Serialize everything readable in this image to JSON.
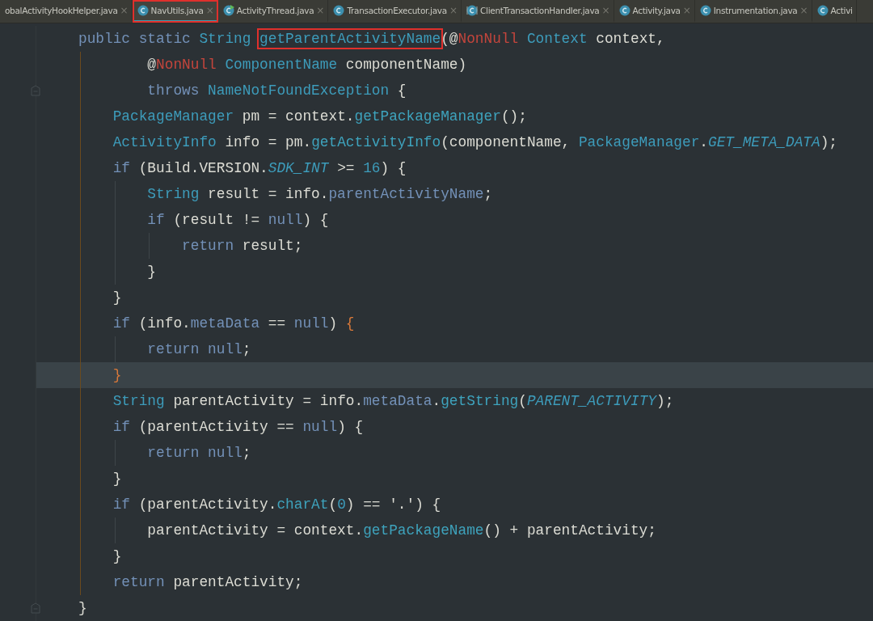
{
  "tabs": [
    {
      "label": "obalActivityHookHelper.java",
      "selected": false
    },
    {
      "label": "NavUtils.java",
      "kind": "class",
      "selected": true,
      "boxed": true
    },
    {
      "label": "ActivityThread.java",
      "kind": "class-run",
      "selected": false
    },
    {
      "label": "TransactionExecutor.java",
      "kind": "class",
      "selected": false
    },
    {
      "label": "ClientTransactionHandler.java",
      "kind": "class-abstract",
      "selected": false
    },
    {
      "label": "Activity.java",
      "kind": "class",
      "selected": false
    },
    {
      "label": "Instrumentation.java",
      "kind": "class",
      "selected": false
    },
    {
      "label": "Activi",
      "kind": "class",
      "selected": false
    }
  ],
  "close_glyph": "×",
  "code_lines": [
    {
      "tokens": [
        {
          "t": "public static ",
          "kind": "keyword"
        },
        {
          "t": "String ",
          "kind": "type"
        },
        {
          "t": "getParentActivityName",
          "kind": "type",
          "boxed": true
        },
        {
          "t": "(@",
          "kind": "plain"
        },
        {
          "t": "NonNull ",
          "kind": "annotation"
        },
        {
          "t": "Context ",
          "kind": "type"
        },
        {
          "t": "context,",
          "kind": "plain"
        }
      ]
    },
    {
      "tokens": [
        {
          "t": "        @",
          "kind": "plain"
        },
        {
          "t": "NonNull ",
          "kind": "annotation"
        },
        {
          "t": "ComponentName ",
          "kind": "type"
        },
        {
          "t": "componentName)",
          "kind": "plain"
        }
      ]
    },
    {
      "fold_marker": true,
      "tokens": [
        {
          "t": "        throws ",
          "kind": "keyword"
        },
        {
          "t": "NameNotFoundException ",
          "kind": "type"
        },
        {
          "t": "{",
          "kind": "plain"
        }
      ]
    },
    {
      "tokens": [
        {
          "t": "    PackageManager ",
          "kind": "type"
        },
        {
          "t": "pm = context.",
          "kind": "plain"
        },
        {
          "t": "getPackageManager",
          "kind": "call"
        },
        {
          "t": "();",
          "kind": "plain"
        }
      ]
    },
    {
      "tokens": [
        {
          "t": "    ActivityInfo ",
          "kind": "type"
        },
        {
          "t": "info = pm.",
          "kind": "plain"
        },
        {
          "t": "getActivityInfo",
          "kind": "call"
        },
        {
          "t": "(componentName, ",
          "kind": "plain"
        },
        {
          "t": "PackageManager",
          "kind": "type"
        },
        {
          "t": ".",
          "kind": "plain"
        },
        {
          "t": "GET_META_DATA",
          "kind": "constant"
        },
        {
          "t": ");",
          "kind": "plain"
        }
      ]
    },
    {
      "tokens": [
        {
          "t": "    if ",
          "kind": "keyword"
        },
        {
          "t": "(Build.VERSION.",
          "kind": "plain"
        },
        {
          "t": "SDK_INT",
          "kind": "constant"
        },
        {
          "t": " >= ",
          "kind": "plain"
        },
        {
          "t": "16",
          "kind": "number"
        },
        {
          "t": ") {",
          "kind": "plain"
        }
      ]
    },
    {
      "tokens": [
        {
          "t": "        String ",
          "kind": "type"
        },
        {
          "t": "result = info.",
          "kind": "plain"
        },
        {
          "t": "parentActivityName",
          "kind": "field"
        },
        {
          "t": ";",
          "kind": "plain"
        }
      ]
    },
    {
      "tokens": [
        {
          "t": "        if ",
          "kind": "keyword"
        },
        {
          "t": "(result != ",
          "kind": "plain"
        },
        {
          "t": "null",
          "kind": "keyword"
        },
        {
          "t": ") {",
          "kind": "plain"
        }
      ]
    },
    {
      "tokens": [
        {
          "t": "            return ",
          "kind": "keyword"
        },
        {
          "t": "result;",
          "kind": "plain"
        }
      ]
    },
    {
      "tokens": [
        {
          "t": "        }",
          "kind": "plain"
        }
      ]
    },
    {
      "tokens": [
        {
          "t": "    }",
          "kind": "plain"
        }
      ]
    },
    {
      "tokens": [
        {
          "t": "    if ",
          "kind": "keyword"
        },
        {
          "t": "(info.",
          "kind": "plain"
        },
        {
          "t": "metaData",
          "kind": "field"
        },
        {
          "t": " == ",
          "kind": "plain"
        },
        {
          "t": "null",
          "kind": "keyword"
        },
        {
          "t": ") ",
          "kind": "plain"
        },
        {
          "t": "{",
          "kind": "brace"
        }
      ]
    },
    {
      "tokens": [
        {
          "t": "        return null",
          "kind": "keyword"
        },
        {
          "t": ";",
          "kind": "plain"
        }
      ]
    },
    {
      "current": true,
      "tokens": [
        {
          "t": "    }",
          "kind": "brace"
        }
      ]
    },
    {
      "tokens": [
        {
          "t": "    String ",
          "kind": "type"
        },
        {
          "t": "parentActivity = info.",
          "kind": "plain"
        },
        {
          "t": "metaData",
          "kind": "field"
        },
        {
          "t": ".",
          "kind": "plain"
        },
        {
          "t": "getString",
          "kind": "call"
        },
        {
          "t": "(",
          "kind": "plain"
        },
        {
          "t": "PARENT_ACTIVITY",
          "kind": "constant"
        },
        {
          "t": ");",
          "kind": "plain"
        }
      ]
    },
    {
      "tokens": [
        {
          "t": "    if ",
          "kind": "keyword"
        },
        {
          "t": "(parentActivity == ",
          "kind": "plain"
        },
        {
          "t": "null",
          "kind": "keyword"
        },
        {
          "t": ") {",
          "kind": "plain"
        }
      ]
    },
    {
      "tokens": [
        {
          "t": "        return null",
          "kind": "keyword"
        },
        {
          "t": ";",
          "kind": "plain"
        }
      ]
    },
    {
      "tokens": [
        {
          "t": "    }",
          "kind": "plain"
        }
      ]
    },
    {
      "tokens": [
        {
          "t": "    if ",
          "kind": "keyword"
        },
        {
          "t": "(parentActivity.",
          "kind": "plain"
        },
        {
          "t": "charAt",
          "kind": "call"
        },
        {
          "t": "(",
          "kind": "plain"
        },
        {
          "t": "0",
          "kind": "number"
        },
        {
          "t": ") == ",
          "kind": "plain"
        },
        {
          "t": "'.'",
          "kind": "string"
        },
        {
          "t": ") {",
          "kind": "plain"
        }
      ]
    },
    {
      "tokens": [
        {
          "t": "        parentActivity = context.",
          "kind": "plain"
        },
        {
          "t": "getPackageName",
          "kind": "call"
        },
        {
          "t": "() + parentActivity;",
          "kind": "plain"
        }
      ]
    },
    {
      "tokens": [
        {
          "t": "    }",
          "kind": "plain"
        }
      ]
    },
    {
      "tokens": [
        {
          "t": "    return ",
          "kind": "keyword"
        },
        {
          "t": "parentActivity;",
          "kind": "plain"
        }
      ]
    },
    {
      "fold_marker": true,
      "tokens": [
        {
          "t": "}",
          "kind": "plain"
        }
      ]
    }
  ]
}
